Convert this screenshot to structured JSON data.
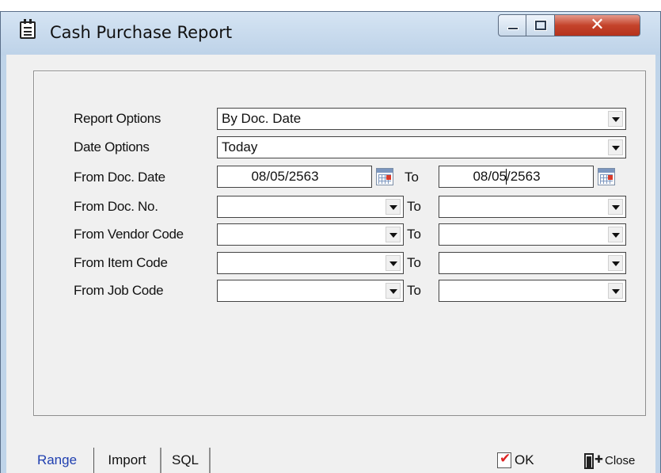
{
  "window": {
    "title": "Cash Purchase Report"
  },
  "form": {
    "report_options": {
      "label": "Report Options",
      "value": "By Doc. Date"
    },
    "date_options": {
      "label": "Date Options",
      "value": "Today"
    },
    "from_doc_date": {
      "label": "From Doc. Date",
      "from": "08/05/2563",
      "to_label": "To",
      "to": "08/05/2563"
    },
    "from_doc_no": {
      "label": "From Doc. No.",
      "from": "",
      "to_label": "To",
      "to": ""
    },
    "from_vendor_code": {
      "label": "From Vendor Code",
      "from": "",
      "to_label": "To",
      "to": ""
    },
    "from_item_code": {
      "label": "From Item Code",
      "from": "",
      "to_label": "To",
      "to": ""
    },
    "from_job_code": {
      "label": "From Job Code",
      "from": "",
      "to_label": "To",
      "to": ""
    }
  },
  "tabs": [
    {
      "label": "Range",
      "active": true
    },
    {
      "label": "Import",
      "active": false
    },
    {
      "label": "SQL",
      "active": false
    }
  ],
  "buttons": {
    "ok": "OK",
    "close": "Close"
  }
}
